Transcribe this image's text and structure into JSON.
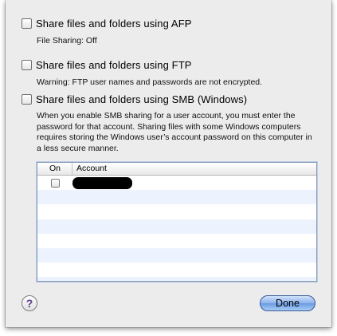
{
  "options": [
    {
      "label": "Share files and folders using AFP",
      "checked": false,
      "note": "File Sharing: Off"
    },
    {
      "label": "Share files and folders using FTP",
      "checked": false,
      "note": "Warning: FTP user names and passwords are not encrypted."
    },
    {
      "label": "Share files and folders using SMB (Windows)",
      "checked": false,
      "note": "When you enable SMB sharing for a user account, you must enter the password for that account. Sharing files with some Windows computers requires storing the Windows user’s account password on this computer in a less secure manner."
    }
  ],
  "table": {
    "headers": {
      "on": "On",
      "account": "Account"
    },
    "rows": [
      {
        "on": false,
        "account": ""
      }
    ]
  },
  "help": {
    "label": "?"
  },
  "done": {
    "label": "Done"
  },
  "colors": {
    "sheet_bg": "#ececec",
    "default_button": "#7aa7e8",
    "help_glyph": "#5b3e8f"
  }
}
